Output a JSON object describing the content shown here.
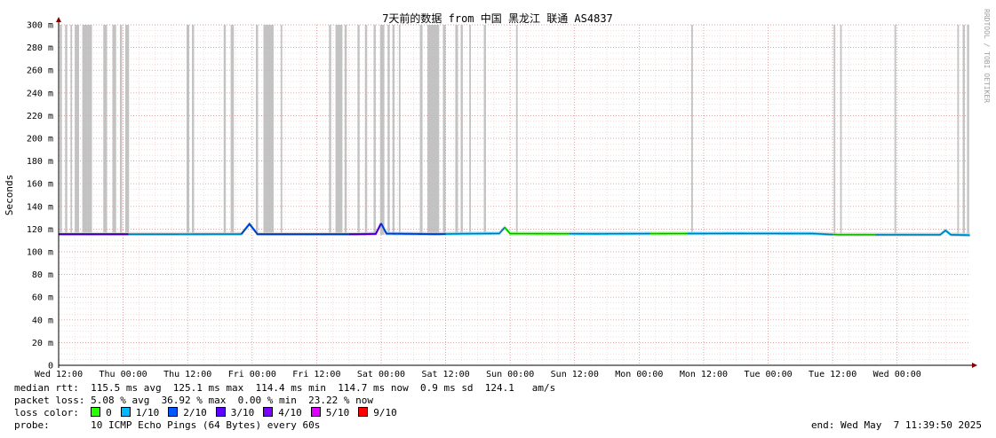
{
  "chart_data": {
    "type": "line",
    "title": "7天前的数据 from 中国 黑龙江 联通 AS4837",
    "ylabel": "Seconds",
    "ylim": [
      0,
      300
    ],
    "yticks": [
      "0",
      "20 m",
      "40 m",
      "60 m",
      "80 m",
      "100 m",
      "120 m",
      "140 m",
      "160 m",
      "180 m",
      "200 m",
      "220 m",
      "240 m",
      "260 m",
      "280 m",
      "300 m"
    ],
    "xticks": [
      "Wed 12:00",
      "Thu 00:00",
      "Thu 12:00",
      "Fri 00:00",
      "Fri 12:00",
      "Sat 00:00",
      "Sat 12:00",
      "Sun 00:00",
      "Sun 12:00",
      "Mon 00:00",
      "Mon 12:00",
      "Tue 00:00",
      "Tue 12:00",
      "Wed 00:00"
    ],
    "x_range_hours": [
      0,
      169.6
    ],
    "grid": true,
    "median_rtt_ms": [
      [
        0,
        115.5
      ],
      [
        20,
        115.5
      ],
      [
        34,
        115.6
      ],
      [
        35.5,
        124.5
      ],
      [
        37,
        115.5
      ],
      [
        55,
        115.5
      ],
      [
        59,
        115.8
      ],
      [
        60,
        125.1
      ],
      [
        61,
        116
      ],
      [
        70,
        115.6
      ],
      [
        82,
        116.2
      ],
      [
        83,
        121.5
      ],
      [
        84,
        116
      ],
      [
        100,
        115.8
      ],
      [
        110,
        116
      ],
      [
        125,
        116.2
      ],
      [
        140,
        116.1
      ],
      [
        145,
        115
      ],
      [
        164,
        115
      ],
      [
        165,
        118.8
      ],
      [
        166,
        115
      ],
      [
        169.6,
        114.7
      ]
    ],
    "loss_color_segments": [
      {
        "from": 0,
        "to": 13,
        "loss": "3/10"
      },
      {
        "from": 13,
        "to": 18,
        "loss": "1/10"
      },
      {
        "from": 18,
        "to": 34,
        "loss": "1/10"
      },
      {
        "from": 34,
        "to": 40,
        "loss": "2/10"
      },
      {
        "from": 40,
        "to": 54,
        "loss": "2/10"
      },
      {
        "from": 54,
        "to": 60,
        "loss": "3/10"
      },
      {
        "from": 60,
        "to": 63,
        "loss": "2/10"
      },
      {
        "from": 63,
        "to": 72,
        "loss": "2/10"
      },
      {
        "from": 72,
        "to": 83,
        "loss": "1/10"
      },
      {
        "from": 83,
        "to": 95,
        "loss": "0"
      },
      {
        "from": 95,
        "to": 110,
        "loss": "1/10"
      },
      {
        "from": 110,
        "to": 117,
        "loss": "0"
      },
      {
        "from": 117,
        "to": 132,
        "loss": "1/10"
      },
      {
        "from": 132,
        "to": 144,
        "loss": "1/10"
      },
      {
        "from": 144,
        "to": 152,
        "loss": "0"
      },
      {
        "from": 152,
        "to": 169.6,
        "loss": "1/10"
      }
    ],
    "outage_bands_hours": [
      [
        0.2,
        0.6
      ],
      [
        1.2,
        1.6
      ],
      [
        2.2,
        2.5
      ],
      [
        3,
        3.8
      ],
      [
        4.4,
        6.2
      ],
      [
        8.3,
        9
      ],
      [
        10,
        10.7
      ],
      [
        11.4,
        11.8
      ],
      [
        12.4,
        13.1
      ],
      [
        23.8,
        24.3
      ],
      [
        24.8,
        25.2
      ],
      [
        30.7,
        31.1
      ],
      [
        32,
        32.6
      ],
      [
        36.7,
        37.1
      ],
      [
        38.1,
        40
      ],
      [
        41.3,
        41.6
      ],
      [
        50.3,
        50.7
      ],
      [
        51.5,
        52.8
      ],
      [
        53.2,
        53.6
      ],
      [
        55.6,
        56
      ],
      [
        57,
        57.4
      ],
      [
        58.6,
        59
      ],
      [
        59.8,
        60.6
      ],
      [
        61.2,
        61.6
      ],
      [
        62.1,
        62.5
      ],
      [
        63.3,
        63.6
      ],
      [
        67.2,
        67.7
      ],
      [
        68.6,
        70.8
      ],
      [
        71.5,
        72
      ],
      [
        73.8,
        74.3
      ],
      [
        74.8,
        75.2
      ],
      [
        76.4,
        76.7
      ],
      [
        79.1,
        79.5
      ],
      [
        85.1,
        85.4
      ],
      [
        117.7,
        118
      ],
      [
        144.2,
        144.5
      ],
      [
        145.4,
        145.7
      ],
      [
        155.5,
        155.8
      ],
      [
        167.2,
        167.5
      ],
      [
        168.2,
        168.6
      ],
      [
        169,
        169.4
      ]
    ],
    "legend": [
      {
        "label": "0",
        "color": "#26ff00"
      },
      {
        "label": "1/10",
        "color": "#00b8ff"
      },
      {
        "label": "2/10",
        "color": "#0059ff"
      },
      {
        "label": "3/10",
        "color": "#5e00ff"
      },
      {
        "label": "4/10",
        "color": "#7e00ff"
      },
      {
        "label": "5/10",
        "color": "#dd00ff"
      },
      {
        "label": "9/10",
        "color": "#ff0000"
      }
    ]
  },
  "stats": {
    "median_rtt": "median rtt:  115.5 ms avg  125.1 ms max  114.4 ms min  114.7 ms now  0.9 ms sd  124.1   am/s",
    "packet_loss": "packet loss: 5.08 % avg  36.92 % max  0.00 % min  23.22 % now",
    "loss_color_label": "loss color:",
    "probe": "probe:       10 ICMP Echo Pings (64 Bytes) every 60s",
    "end": "end: Wed May  7 11:39:50 2025"
  },
  "watermark": "RRDTOOL / TOBI OETIKER",
  "colors": {
    "grid_major": "#d08080",
    "grid_minor": "#e8c8c8",
    "smoke": "#b8b8b8",
    "axis": "#000000",
    "arrow": "#800000"
  }
}
